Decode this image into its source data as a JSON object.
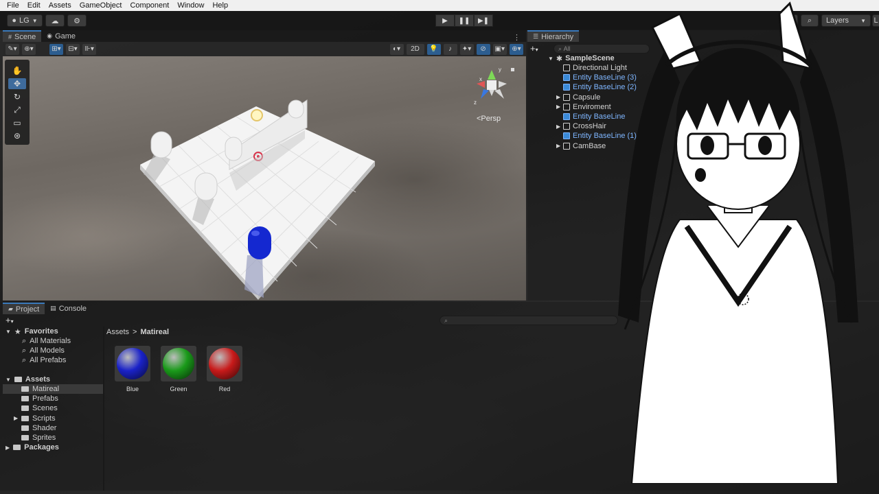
{
  "menu": [
    "File",
    "Edit",
    "Assets",
    "GameObject",
    "Component",
    "Window",
    "Help"
  ],
  "toolbar": {
    "account": "LG",
    "layers_label": "Layers",
    "layout_label": "L"
  },
  "scene_panel": {
    "tabs": [
      {
        "label": "Scene",
        "active": true
      },
      {
        "label": "Game",
        "active": false
      }
    ],
    "toggle_2d": "2D",
    "persp_label": "<Persp",
    "gizmo_axes": [
      "x",
      "y",
      "z"
    ]
  },
  "hierarchy": {
    "tab": "Hierarchy",
    "search_placeholder": "All",
    "scene_name": "SampleScene",
    "items": [
      {
        "label": "Directional Light",
        "prefab": false,
        "expandable": false
      },
      {
        "label": "Entity BaseLine (3)",
        "prefab": true,
        "expandable": false
      },
      {
        "label": "Entity BaseLine (2)",
        "prefab": true,
        "expandable": false
      },
      {
        "label": "Capsule",
        "prefab": false,
        "expandable": true
      },
      {
        "label": "Enviroment",
        "prefab": false,
        "expandable": true
      },
      {
        "label": "Entity BaseLine",
        "prefab": true,
        "expandable": false
      },
      {
        "label": "CrossHair",
        "prefab": false,
        "expandable": true
      },
      {
        "label": "Entity BaseLine (1)",
        "prefab": true,
        "expandable": false
      },
      {
        "label": "CamBase",
        "prefab": false,
        "expandable": true
      }
    ]
  },
  "project": {
    "tabs": [
      {
        "label": "Project",
        "active": true
      },
      {
        "label": "Console",
        "active": false
      }
    ],
    "favorites_label": "Favorites",
    "favorites": [
      "All Materials",
      "All Models",
      "All Prefabs"
    ],
    "assets_label": "Assets",
    "folders": [
      {
        "label": "Matireal",
        "selected": true,
        "expandable": false
      },
      {
        "label": "Prefabs",
        "selected": false,
        "expandable": false
      },
      {
        "label": "Scenes",
        "selected": false,
        "expandable": false
      },
      {
        "label": "Scripts",
        "selected": false,
        "expandable": true
      },
      {
        "label": "Shader",
        "selected": false,
        "expandable": false
      },
      {
        "label": "Sprites",
        "selected": false,
        "expandable": false
      }
    ],
    "packages_label": "Packages",
    "breadcrumb": {
      "root": "Assets",
      "separator": ">",
      "current": "Matireal"
    },
    "materials": [
      {
        "name": "Blue",
        "color": "#1a22c8"
      },
      {
        "name": "Green",
        "color": "#1a9a1a"
      },
      {
        "name": "Red",
        "color": "#c81a1a"
      }
    ]
  },
  "colors": {
    "accent": "#3a79bb",
    "prefab_text": "#7fb6ff",
    "menubar_bg": "#f0f0f0"
  }
}
